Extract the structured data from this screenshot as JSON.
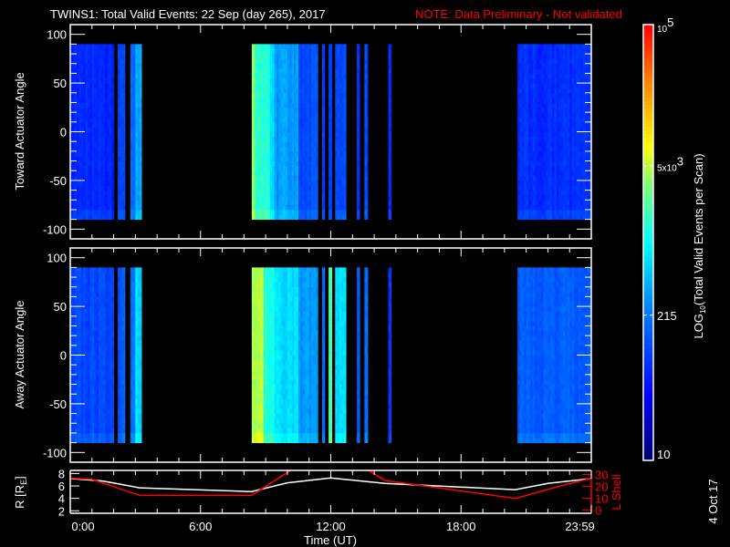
{
  "header": {
    "title": "TWINS1: Total Valid Events: 22 Sep (day 265), 2017",
    "note": "NOTE: Data Preliminary - Not validated"
  },
  "date_stamp": "4 Oct 17",
  "colors": {
    "background": "#000000",
    "axes": "#ffffff",
    "note": "#ff0000",
    "r_line": "#ffffff",
    "lshell_line": "#ff0000"
  },
  "chart_data": [
    {
      "type": "heatmap",
      "name": "toward",
      "ylabel": "Toward Actuator Angle",
      "xlabel": "",
      "xlim": [
        0,
        24
      ],
      "ylim": [
        -110,
        110
      ],
      "yticks": [
        100,
        50,
        0,
        -50,
        -100
      ],
      "data_angle_range": [
        -90,
        90
      ],
      "segments_hours_counts": [
        {
          "start": 0.0,
          "end": 2.0,
          "counts": 70
        },
        {
          "start": 2.19,
          "end": 2.52,
          "counts": 110
        },
        {
          "start": 2.77,
          "end": 3.0,
          "counts": 160
        },
        {
          "start": 3.0,
          "end": 3.28,
          "counts": 380
        },
        {
          "start": 8.36,
          "end": 8.5,
          "counts": 3500
        },
        {
          "start": 8.5,
          "end": 9.2,
          "counts": 1500
        },
        {
          "start": 9.2,
          "end": 9.4,
          "counts": 600
        },
        {
          "start": 9.4,
          "end": 10.5,
          "counts": 350
        },
        {
          "start": 10.5,
          "end": 11.4,
          "counts": 120
        },
        {
          "start": 11.6,
          "end": 11.72,
          "counts": 85
        },
        {
          "start": 11.9,
          "end": 12.05,
          "counts": 90
        },
        {
          "start": 12.2,
          "end": 12.7,
          "counts": 110
        },
        {
          "start": 13.2,
          "end": 13.33,
          "counts": 80
        },
        {
          "start": 13.55,
          "end": 13.7,
          "counts": 110
        },
        {
          "start": 14.65,
          "end": 14.78,
          "counts": 70
        },
        {
          "start": 20.6,
          "end": 24.0,
          "counts": 80
        }
      ]
    },
    {
      "type": "heatmap",
      "name": "away",
      "ylabel": "Away Actuator Angle",
      "xlabel": "",
      "xlim": [
        0,
        24
      ],
      "ylim": [
        -110,
        110
      ],
      "yticks": [
        100,
        50,
        0,
        -50,
        -100
      ],
      "data_angle_range": [
        -90,
        90
      ],
      "segments_hours_counts": [
        {
          "start": 0.0,
          "end": 2.0,
          "counts": 110
        },
        {
          "start": 2.19,
          "end": 2.52,
          "counts": 150
        },
        {
          "start": 2.77,
          "end": 3.0,
          "counts": 200
        },
        {
          "start": 3.0,
          "end": 3.28,
          "counts": 700
        },
        {
          "start": 8.36,
          "end": 8.9,
          "counts": 5000
        },
        {
          "start": 8.9,
          "end": 9.4,
          "counts": 1500
        },
        {
          "start": 9.4,
          "end": 10.5,
          "counts": 700
        },
        {
          "start": 10.5,
          "end": 11.4,
          "counts": 350
        },
        {
          "start": 11.6,
          "end": 11.72,
          "counts": 200
        },
        {
          "start": 11.9,
          "end": 12.05,
          "counts": 2500
        },
        {
          "start": 12.2,
          "end": 12.7,
          "counts": 700
        },
        {
          "start": 13.2,
          "end": 13.33,
          "counts": 150
        },
        {
          "start": 13.55,
          "end": 13.7,
          "counts": 200
        },
        {
          "start": 14.65,
          "end": 14.78,
          "counts": 90
        },
        {
          "start": 20.6,
          "end": 24.0,
          "counts": 150
        }
      ]
    },
    {
      "type": "line",
      "name": "ephemeris",
      "xlabel": "Time (UT)",
      "xlim": [
        0,
        24
      ],
      "xticks": [
        {
          "value": 0,
          "label": "0:00"
        },
        {
          "value": 6,
          "label": "6:00"
        },
        {
          "value": 12,
          "label": "12:00"
        },
        {
          "value": 18,
          "label": "18:00"
        },
        {
          "value": 23.98,
          "label": "23:59"
        }
      ],
      "ylabel_left": "R [RE]",
      "ylim_left": [
        1.6,
        8.5
      ],
      "yticks_left": [
        2,
        4,
        6,
        8
      ],
      "ylabel_right": "L Shell",
      "ylim_right": [
        -2.5,
        33.5
      ],
      "yticks_right": [
        0,
        10,
        20,
        30
      ],
      "series": [
        {
          "name": "R",
          "axis": "left",
          "x": [
            0,
            1.5,
            3.2,
            8.35,
            10,
            12,
            14.5,
            20.5,
            22,
            24
          ],
          "y": [
            7.2,
            6.8,
            5.7,
            5.1,
            6.5,
            7.3,
            6.4,
            5.4,
            6.4,
            7.2
          ]
        },
        {
          "name": "L Shell",
          "axis": "right",
          "x": [
            0,
            1.0,
            3.2,
            8.35,
            10.2,
            13.7,
            14.5,
            20.5,
            22.5,
            24
          ],
          "y": [
            27,
            26,
            12.5,
            12.5,
            34,
            34,
            25,
            10,
            20,
            27
          ]
        }
      ]
    }
  ],
  "colorbar": {
    "label": "LOG10(Total Valid Events per Scan)",
    "label_prefix": "LOG",
    "label_sub": "10",
    "label_suffix": "(Total Valid Events per Scan)",
    "range": [
      10,
      100000
    ],
    "ticks": [
      {
        "value": 100000,
        "base": "10",
        "exp": "5"
      },
      {
        "value": 5000,
        "base": "5x10",
        "exp": "3"
      },
      {
        "value": 215,
        "base": "215",
        "exp": ""
      },
      {
        "value": 10,
        "base": "10",
        "exp": ""
      }
    ]
  },
  "ephem_labels": {
    "r_main": "R [R",
    "r_sub": "E",
    "r_close": "]",
    "lshell": "L Shell"
  }
}
